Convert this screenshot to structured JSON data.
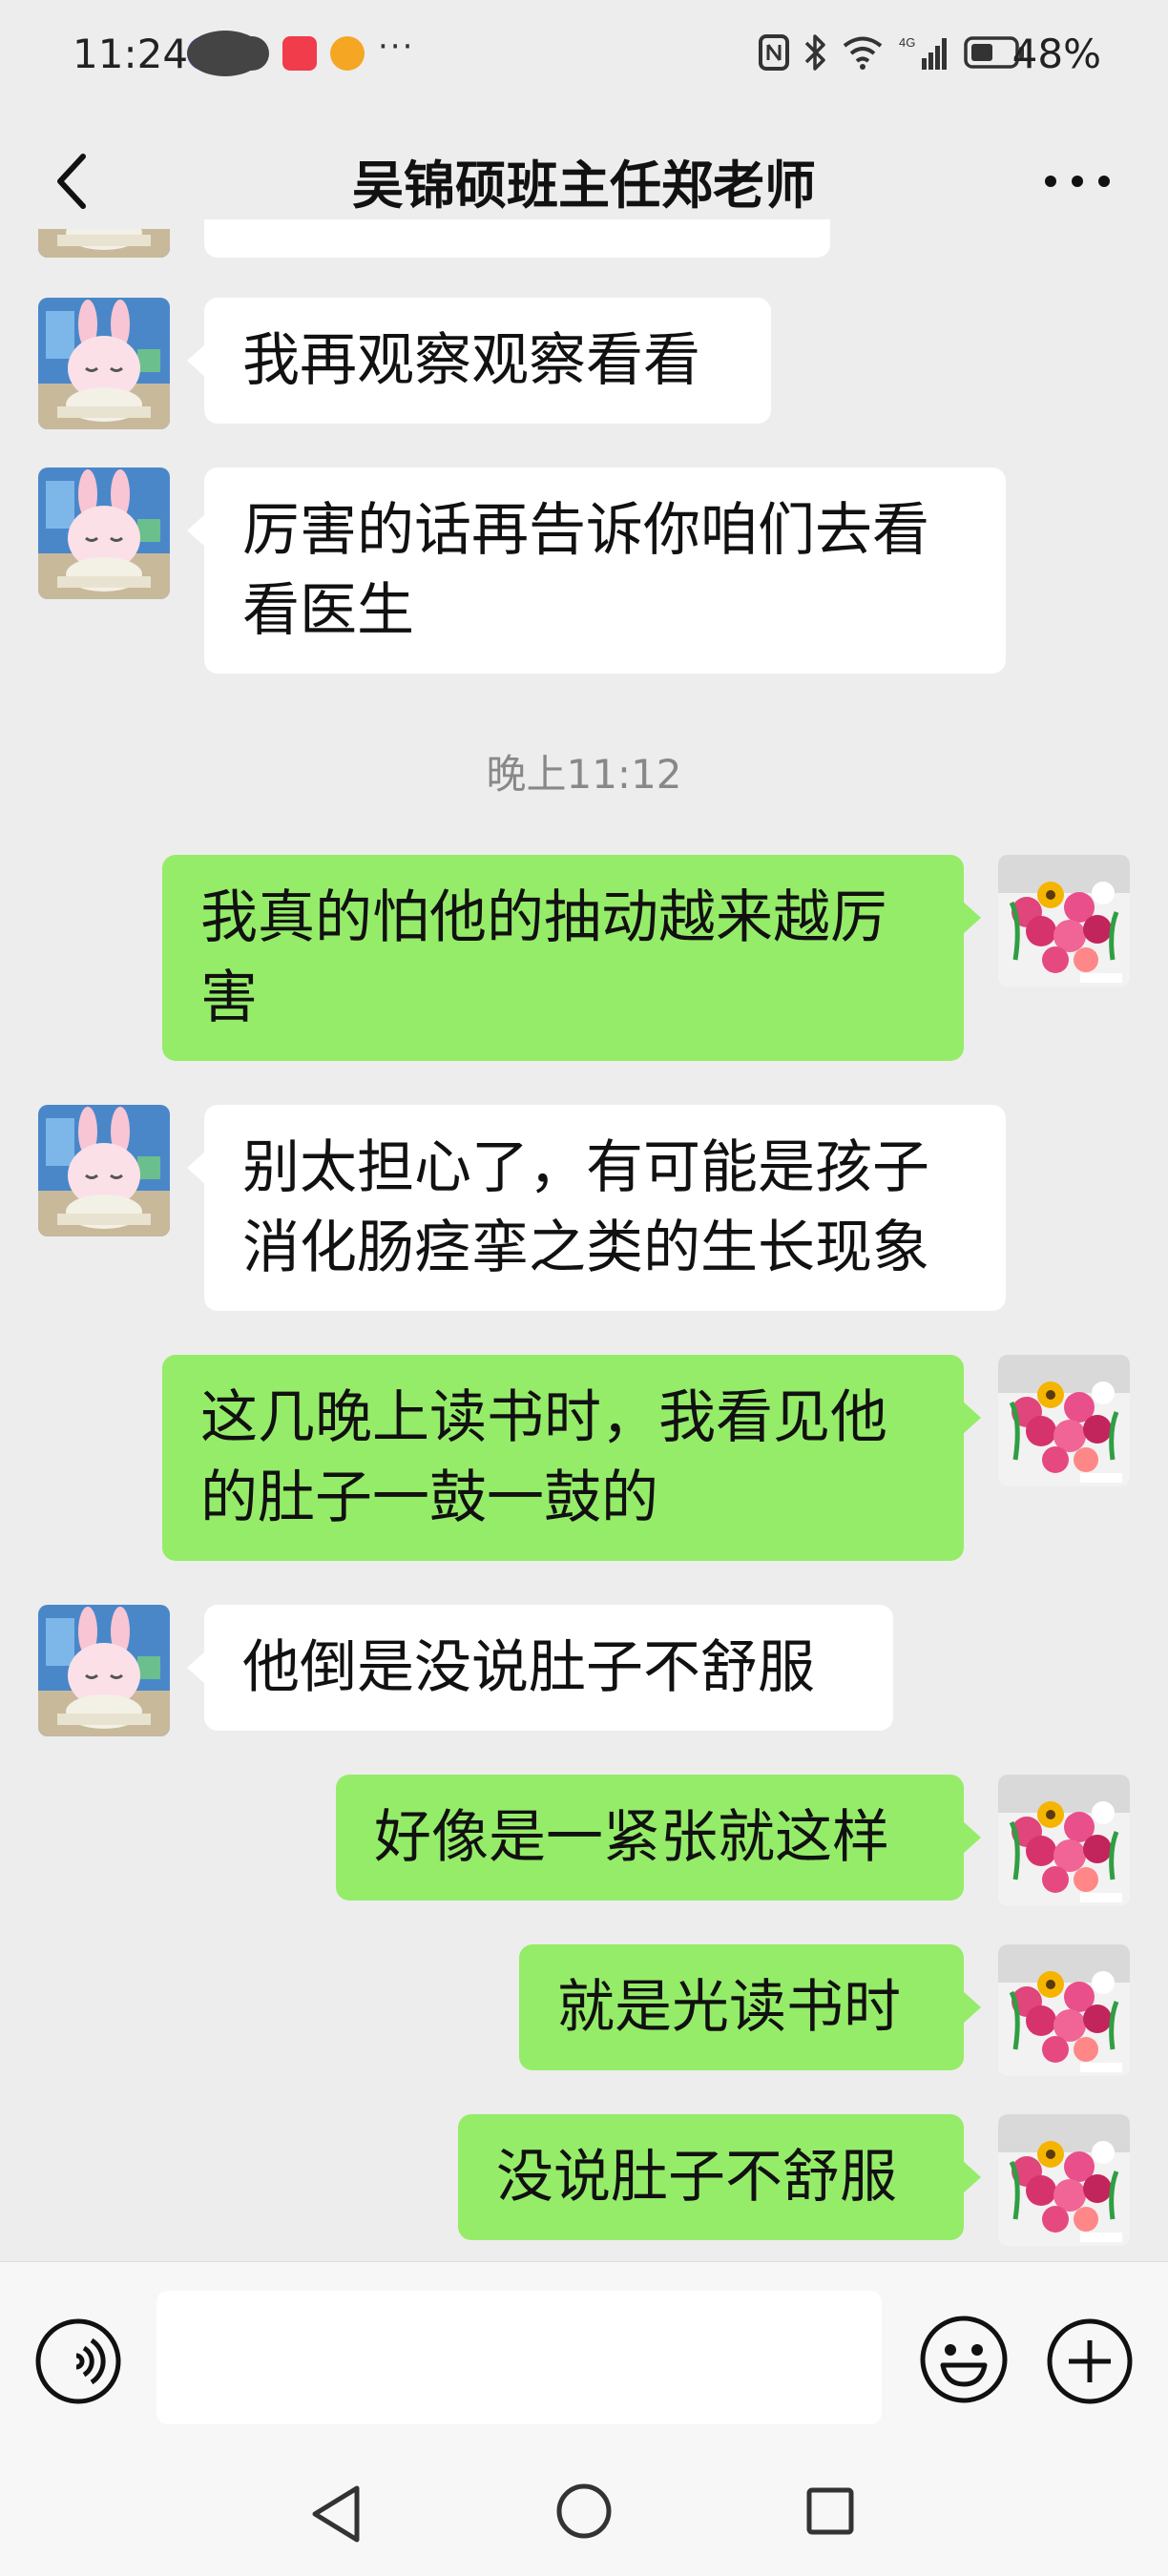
{
  "status_bar": {
    "time": "11:24",
    "more": "···",
    "battery": "48%",
    "network": "4G"
  },
  "header": {
    "title": "吴锦硕班主任郑老师"
  },
  "messages": [
    {
      "side": "left",
      "text": "我再观察观察看看"
    },
    {
      "side": "left",
      "text": "厉害的话再告诉你咱们去看看医生"
    },
    {
      "type": "timestamp",
      "text": "晚上11:12"
    },
    {
      "side": "right",
      "text": "我真的怕他的抽动越来越厉害"
    },
    {
      "side": "left",
      "text": "别太担心了，有可能是孩子消化肠痉挛之类的生长现象"
    },
    {
      "side": "right",
      "text": "这几晚上读书时，我看见他的肚子一鼓一鼓的"
    },
    {
      "side": "left",
      "text": "他倒是没说肚子不舒服"
    },
    {
      "side": "right",
      "text": "好像是一紧张就这样"
    },
    {
      "side": "right",
      "text": "就是光读书时"
    },
    {
      "side": "right",
      "text": "没说肚子不舒服"
    }
  ],
  "input": {
    "value": "",
    "placeholder": ""
  },
  "icons": {
    "back": "chevron-left-icon",
    "more": "more-horizontal-icon",
    "voice": "voice-icon",
    "emoji": "smiley-icon",
    "plus": "plus-icon"
  },
  "colors": {
    "background": "#ededed",
    "bubble_self": "#95ec69",
    "bubble_other": "#ffffff"
  }
}
